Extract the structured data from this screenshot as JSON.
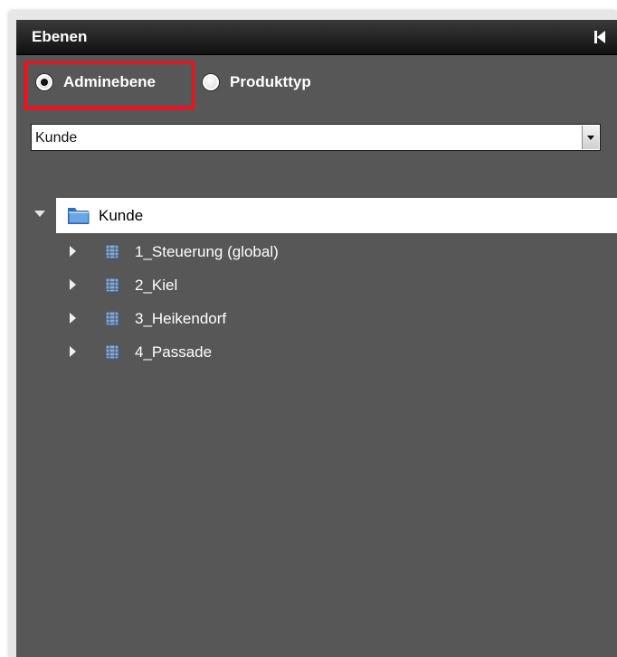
{
  "panel": {
    "title": "Ebenen",
    "collapse_icon": "collapse-left-icon"
  },
  "view_mode": {
    "options": [
      {
        "label": "Adminebene",
        "checked": true
      },
      {
        "label": "Produkttyp",
        "checked": false
      }
    ],
    "highlight_color": "#e8141e"
  },
  "level_select": {
    "value": "Kunde"
  },
  "tree": {
    "root": {
      "label": "Kunde",
      "icon": "folder-icon",
      "expanded": true
    },
    "items": [
      {
        "label": "1_Steuerung (global)",
        "icon": "database-icon"
      },
      {
        "label": "2_Kiel",
        "icon": "database-icon"
      },
      {
        "label": "3_Heikendorf",
        "icon": "database-icon"
      },
      {
        "label": "4_Passade",
        "icon": "database-icon"
      }
    ]
  },
  "colors": {
    "panel_bg": "#575757",
    "titlebar": "#1a1a1a",
    "text": "#ffffff"
  }
}
